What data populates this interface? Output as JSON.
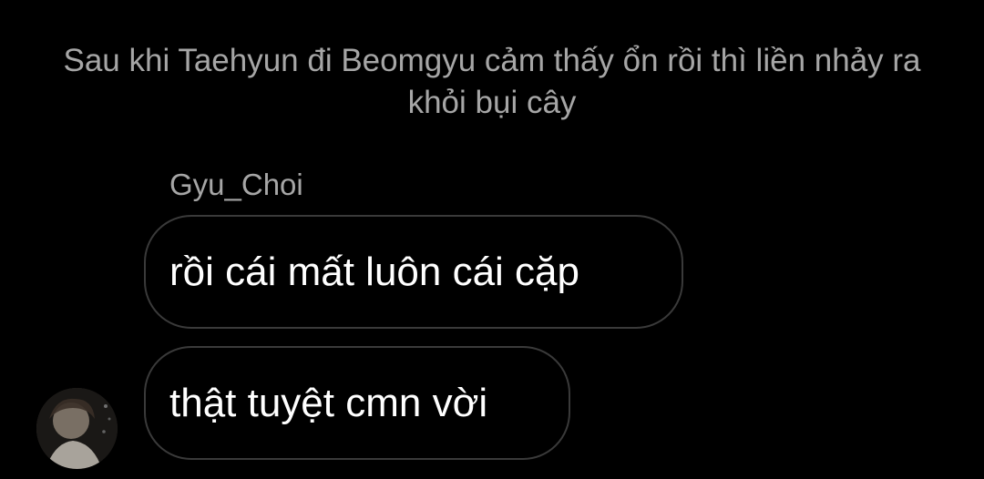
{
  "narration": {
    "text": "Sau khi Taehyun đi Beomgyu cảm thấy ổn rồi thì liền nhảy ra khỏi bụi cây"
  },
  "message_group": {
    "sender_name": "Gyu_Choi",
    "messages": [
      {
        "text": "rồi cái mất luôn cái cặp"
      },
      {
        "text": "thật tuyệt cmn vời"
      }
    ]
  },
  "colors": {
    "background": "#000000",
    "narration_text": "#a6a6a6",
    "bubble_border": "#3a3a3a",
    "message_text": "#ffffff"
  }
}
